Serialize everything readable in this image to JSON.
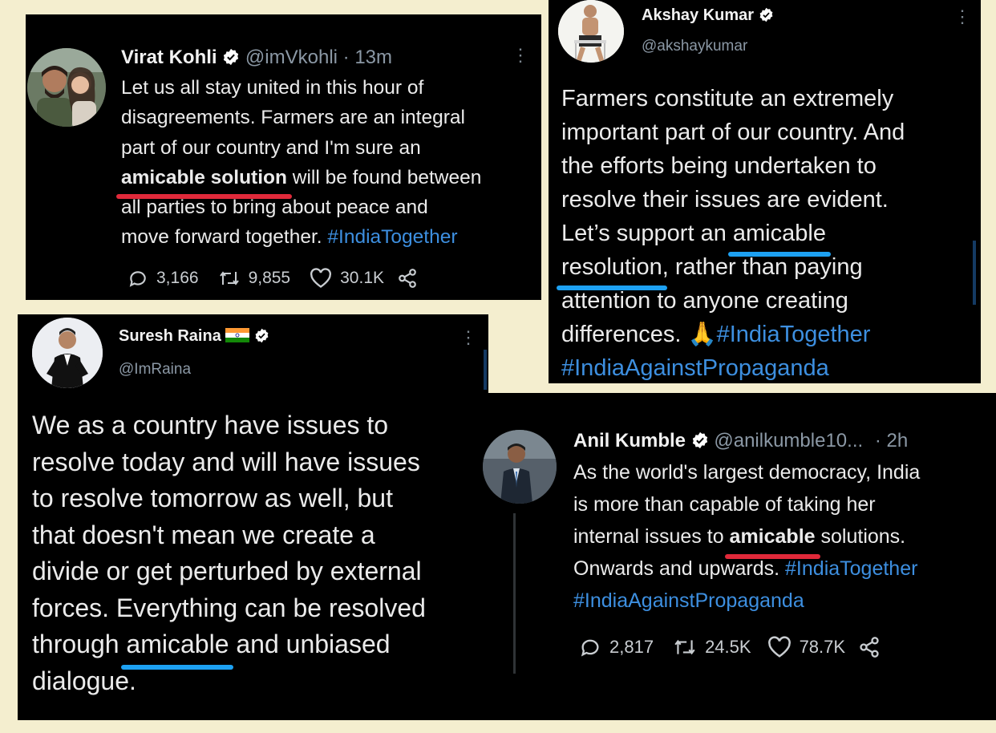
{
  "tweets": {
    "kohli": {
      "name": "Virat Kohli",
      "handle": "@imVkohli",
      "time": "· 13m",
      "lines": [
        "Let us all stay united in this hour of",
        "disagreements. Farmers are an integral",
        "part of our country and I'm sure an"
      ],
      "line4_hl": "amicable solution",
      "line4_rest": " will be found between",
      "line5": "all parties to bring about peace and",
      "line6_text": "move forward together. ",
      "hashtag": "#IndiaTogether",
      "replies": "3,166",
      "retweets": "9,855",
      "likes": "30.1K"
    },
    "akshay": {
      "name": "Akshay Kumar",
      "handle": "@akshaykumar",
      "lines": [
        "Farmers constitute an extremely",
        "important part of our country. And",
        "the efforts being undertaken to",
        "resolve their issues are evident."
      ],
      "line5_pre": "Let’s support an ",
      "line5_hl": "amicable",
      "line6_hl": "resolution",
      "line6_rest": ", rather than paying",
      "line7": "attention to anyone creating",
      "line8_text": "differences. ",
      "emoji": "🙏",
      "hashtag1": "#IndiaTogether",
      "hashtag2": "#IndiaAgainstPropaganda"
    },
    "raina": {
      "name": "Suresh Raina",
      "handle": "@ImRaina",
      "lines": [
        "We as a country have issues to",
        "resolve today and will have issues",
        "to resolve tomorrow as well, but",
        "that doesn't mean we create a",
        "divide or get perturbed by external",
        "forces. Everything can be resolved"
      ],
      "line7_pre": "through ",
      "line7_hl": "amicable",
      "line7_rest": " and unbiased",
      "line8": "dialogue."
    },
    "kumble": {
      "name": "Anil Kumble",
      "handle": "@anilkumble10...",
      "time": "· 2h",
      "lines": [
        "As the world's largest democracy, India",
        "is more than capable of taking her"
      ],
      "line3_pre": "internal issues to ",
      "line3_hl": "amicable",
      "line3_rest": " solutions.",
      "line4_text": "Onwards and upwards. ",
      "hashtag1": "#IndiaTogether",
      "hashtag2": "#IndiaAgainstPropaganda",
      "replies": "2,817",
      "retweets": "24.5K",
      "likes": "78.7K"
    }
  },
  "colors": {
    "background": "#f4eecf",
    "card": "#000000",
    "hashtag": "#3d8fe0",
    "underline_red": "#e0293a",
    "underline_blue": "#1da1f2",
    "verified": "#ffffff"
  },
  "icons": [
    "verified-badge-icon",
    "more-options-icon",
    "reply-icon",
    "retweet-icon",
    "like-icon",
    "share-icon",
    "india-flag-icon",
    "folded-hands-emoji"
  ]
}
